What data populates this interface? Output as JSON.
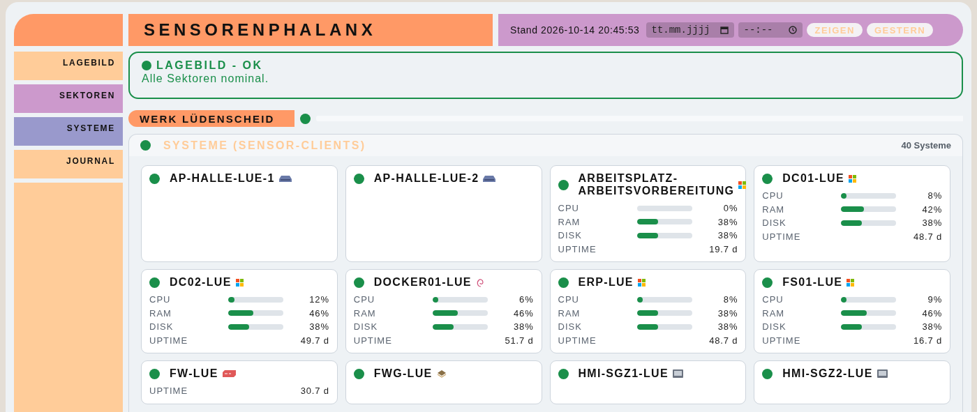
{
  "header": {
    "title": "SENSORENPHALANX",
    "stand": "Stand 2026-10-14 20:45:53",
    "date_placeholder": "tt.mm.jjjj",
    "time_placeholder": "--:--",
    "buttons": [
      "ZEIGEN",
      "GESTERN"
    ]
  },
  "sidebar": {
    "items": [
      {
        "label": "LAGEBILD",
        "color": "#ffcc99"
      },
      {
        "label": "SEKTOREN",
        "color": "#cc99cc"
      },
      {
        "label": "SYSTEME",
        "color": "#9999cc"
      },
      {
        "label": "JOURNAL",
        "color": "#ffcc99"
      }
    ]
  },
  "banner": {
    "title": "LAGEBILD - OK",
    "message": "Alle Sektoren nominal."
  },
  "sector": {
    "name": "WERK LÜDENSCHEID"
  },
  "systems": {
    "title": "SYSTEME (SENSOR-CLIENTS)",
    "count": "40 Systeme",
    "items": [
      {
        "name": "AP-HALLE-LUE-1",
        "kind": "switch"
      },
      {
        "name": "AP-HALLE-LUE-2",
        "kind": "switch"
      },
      {
        "name": "ARBEITSPLATZ-ARBEITSVORBEREITUNG",
        "kind": "windows",
        "metrics": [
          {
            "kind": "bar",
            "label": "CPU",
            "level": 0,
            "reading": "0%"
          },
          {
            "kind": "bar",
            "label": "RAM",
            "level": 0.38,
            "reading": "38%"
          },
          {
            "kind": "bar",
            "label": "DISK",
            "level": 0.38,
            "reading": "38%"
          },
          {
            "kind": "text",
            "label": "UPTIME",
            "reading": "19.7 d"
          }
        ]
      },
      {
        "name": "DC01-LUE",
        "kind": "windows",
        "metrics": [
          {
            "kind": "bar",
            "label": "CPU",
            "level": 0.08,
            "reading": "8%"
          },
          {
            "kind": "bar",
            "label": "RAM",
            "level": 0.42,
            "reading": "42%"
          },
          {
            "kind": "bar",
            "label": "DISK",
            "level": 0.38,
            "reading": "38%"
          },
          {
            "kind": "text",
            "label": "UPTIME",
            "reading": "48.7 d"
          }
        ]
      },
      {
        "name": "DC02-LUE",
        "kind": "windows",
        "metrics": [
          {
            "kind": "bar",
            "label": "CPU",
            "level": 0.12,
            "reading": "12%"
          },
          {
            "kind": "bar",
            "label": "RAM",
            "level": 0.46,
            "reading": "46%"
          },
          {
            "kind": "bar",
            "label": "DISK",
            "level": 0.38,
            "reading": "38%"
          },
          {
            "kind": "text",
            "label": "UPTIME",
            "reading": "49.7 d"
          }
        ]
      },
      {
        "name": "DOCKER01-LUE",
        "kind": "debian",
        "metrics": [
          {
            "kind": "bar",
            "label": "CPU",
            "level": 0.06,
            "reading": "6%"
          },
          {
            "kind": "bar",
            "label": "RAM",
            "level": 0.46,
            "reading": "46%"
          },
          {
            "kind": "bar",
            "label": "DISK",
            "level": 0.38,
            "reading": "38%"
          },
          {
            "kind": "text",
            "label": "UPTIME",
            "reading": "51.7 d"
          }
        ]
      },
      {
        "name": "ERP-LUE",
        "kind": "windows",
        "metrics": [
          {
            "kind": "bar",
            "label": "CPU",
            "level": 0.08,
            "reading": "8%"
          },
          {
            "kind": "bar",
            "label": "RAM",
            "level": 0.38,
            "reading": "38%"
          },
          {
            "kind": "bar",
            "label": "DISK",
            "level": 0.38,
            "reading": "38%"
          },
          {
            "kind": "text",
            "label": "UPTIME",
            "reading": "48.7 d"
          }
        ]
      },
      {
        "name": "FS01-LUE",
        "kind": "windows",
        "metrics": [
          {
            "kind": "bar",
            "label": "CPU",
            "level": 0.09,
            "reading": "9%"
          },
          {
            "kind": "bar",
            "label": "RAM",
            "level": 0.46,
            "reading": "46%"
          },
          {
            "kind": "bar",
            "label": "DISK",
            "level": 0.38,
            "reading": "38%"
          },
          {
            "kind": "text",
            "label": "UPTIME",
            "reading": "16.7 d"
          }
        ]
      },
      {
        "name": "FW-LUE",
        "kind": "firewall",
        "metrics": [
          {
            "kind": "text",
            "label": "UPTIME",
            "reading": "30.7 d"
          }
        ]
      },
      {
        "name": "FWG-LUE",
        "kind": "chip"
      },
      {
        "name": "HMI-SGZ1-LUE",
        "kind": "hmi"
      },
      {
        "name": "HMI-SGZ2-LUE",
        "kind": "hmi"
      }
    ]
  }
}
